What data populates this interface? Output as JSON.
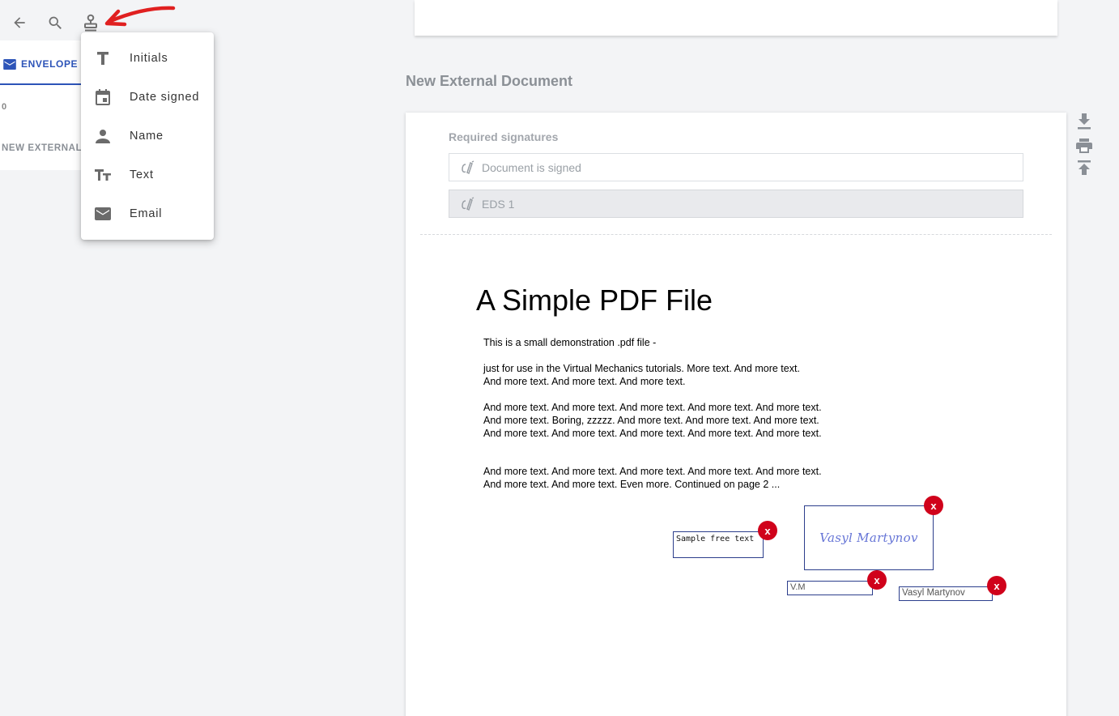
{
  "toolbar": {
    "back_icon": "arrow-back-icon",
    "search_icon": "search-icon",
    "stamp_icon": "stamp-icon"
  },
  "left_panel": {
    "tab_label": "ENVELOPE D",
    "count": "0",
    "doc_label": "NEW EXTERNAL"
  },
  "menu": {
    "items": [
      {
        "label": "Initials",
        "icon": "text-t-icon"
      },
      {
        "label": "Date signed",
        "icon": "calendar-icon"
      },
      {
        "label": "Name",
        "icon": "person-icon"
      },
      {
        "label": "Text",
        "icon": "text-size-icon"
      },
      {
        "label": "Email",
        "icon": "envelope-icon"
      }
    ]
  },
  "document": {
    "heading": "New External Document",
    "required_label": "Required signatures",
    "signatures": [
      {
        "label": "Document is signed"
      },
      {
        "label": "EDS 1"
      }
    ]
  },
  "pdf": {
    "title": "A Simple PDF File",
    "paragraphs": [
      "This is a small demonstration .pdf file -",
      "just for use in the Virtual Mechanics tutorials. More text. And more text. And more text. And more text. And more text.",
      "And more text. And more text. And more text. And more text. And more text. And more text. Boring, zzzzz. And more text. And more text. And more text. And more text. And more text. And more text. And more text. And more text.",
      "And more text. And more text. And more text. And more text. And more text. And more text. And more text. Even more. Continued on page 2 ..."
    ]
  },
  "fields": {
    "free_text": "Sample free text",
    "signature": "Vasyl Martynov",
    "initials": "V.M",
    "name": "Vasyl Martynov",
    "delete_label": "x"
  },
  "side_actions": [
    "download-icon",
    "print-icon",
    "upload-icon"
  ],
  "colors": {
    "accent": "#2d54b8",
    "delete": "#d0021b",
    "annotation_arrow": "#e02020",
    "signature_ink": "#6675d6"
  }
}
